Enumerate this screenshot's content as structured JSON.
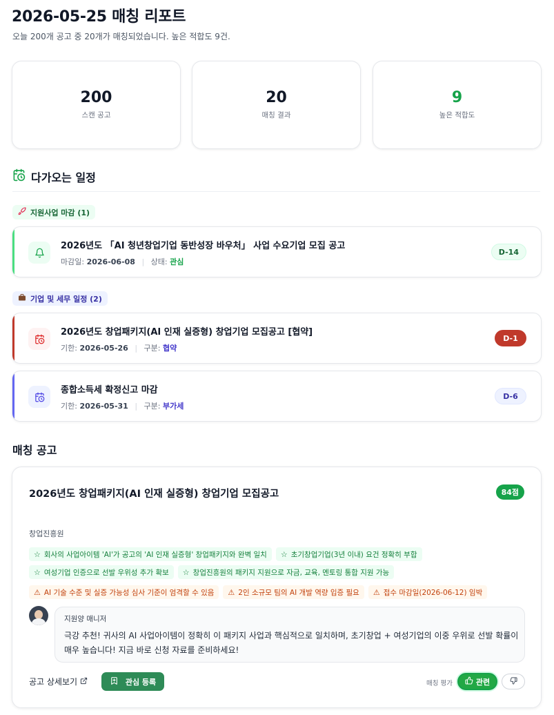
{
  "page": {
    "title": "2026-05-25 매칭 리포트",
    "subtitle": "오늘 200개 공고 중 20개가 매칭되었습니다. 높은 적합도 9건."
  },
  "stats": [
    {
      "value": "200",
      "label": "스캔 공고",
      "color": "#111827"
    },
    {
      "value": "20",
      "label": "매칭 결과",
      "color": "#111827"
    },
    {
      "value": "9",
      "label": "높은 적합도",
      "color": "#16a34a"
    }
  ],
  "schedule": {
    "heading": "다가오는 일정",
    "icon": "calendar-clock-icon",
    "groups": [
      {
        "label": "지원사업 마감 (1)",
        "icon": "rocket-icon",
        "bg": "#ecfdf3",
        "fg": "#166534",
        "events": [
          {
            "title": "2026년도 「AI 청년창업기업 동반성장 바우처」 사업 수요기업 모집 공고",
            "date_label": "마감일:",
            "date": "2026-06-08",
            "type_label": "상태:",
            "type": "관심",
            "type_color": "#16a34a",
            "dday": "D-14",
            "icon": "bell-icon",
            "accent": "#4ade80",
            "icon_bg": "#ecfdf3",
            "icon_fg": "#16a34a",
            "dday_bg": "#ecfdf3",
            "dday_fg": "#166534",
            "dday_border": "#d1fae5"
          }
        ]
      },
      {
        "label": "기업 및 세무 일정 (2)",
        "icon": "briefcase-icon",
        "bg": "#eef2ff",
        "fg": "#3730a3",
        "events": [
          {
            "title": "2026년도 창업패키지(AI 인재 실증형) 창업기업 모집공고 [협약]",
            "date_label": "기한:",
            "date": "2026-05-26",
            "type_label": "구분:",
            "type": "협약",
            "type_color": "#4338ca",
            "dday": "D-1",
            "icon": "calendar-clock-icon",
            "accent": "#c0392b",
            "icon_bg": "#fef2f2",
            "icon_fg": "#dc2626",
            "dday_bg": "#c0392b",
            "dday_fg": "#ffffff",
            "dday_border": "#c0392b"
          },
          {
            "title": "종합소득세 확정신고 마감",
            "date_label": "기한:",
            "date": "2026-05-31",
            "type_label": "구분:",
            "type": "부가세",
            "type_color": "#4338ca",
            "dday": "D-6",
            "icon": "calendar-clock-icon",
            "accent": "#6366f1",
            "icon_bg": "#eef2ff",
            "icon_fg": "#4f46e5",
            "dday_bg": "#eef2ff",
            "dday_fg": "#3730a3",
            "dday_border": "#e0e7ff"
          }
        ]
      }
    ]
  },
  "matches": {
    "heading": "매칭 공고",
    "items": [
      {
        "title": "2026년도 창업패키지(AI 인재 실증형) 창업기업 모집공고",
        "score": "84점",
        "org": "창업진흥원",
        "strengths": [
          "회사의 사업아이템 'AI'가 공고의 'AI 인재 실증형' 창업패키지와 완벽 일치",
          "초기창업기업(3년 이내) 요건 정확히 부합",
          "여성기업 인증으로 선발 우위성 추가 확보",
          "창업진흥원의 패키지 지원으로 자금, 교육, 멘토링 통합 지원 가능"
        ],
        "risks": [
          "AI 기술 수준 및 실증 가능성 심사 기준이 엄격할 수 있음",
          "2인 소규모 팀의 AI 개발 역량 입증 필요",
          "접수 마감일(2026-06-12) 임박"
        ],
        "manager": "지원양 매니저",
        "comment": "극강 추천! 귀사의 AI 사업아이템이 정확히 이 패키지 사업과 핵심적으로 일치하며, 초기창업 + 여성기업의 이중 우위로 선발 확률이 매우 높습니다! 지금 바로 신청 자료를 준비하세요!",
        "detail_link": "공고 상세보기",
        "fav_button": "관심 등록",
        "rating_label": "매칭 평가",
        "relevant_button": "관련"
      }
    ]
  }
}
